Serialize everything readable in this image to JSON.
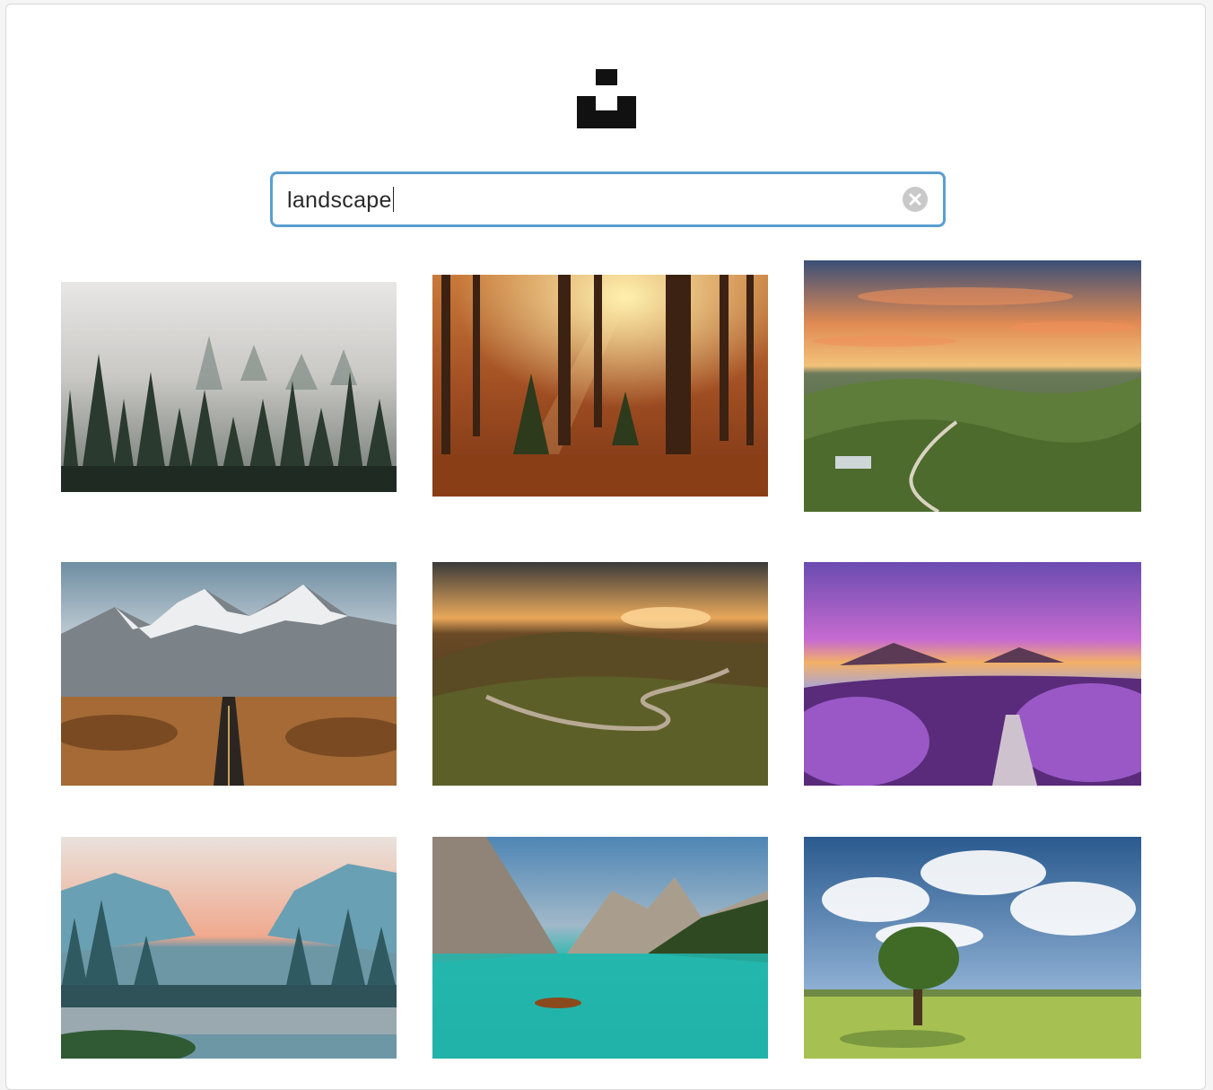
{
  "logo": {
    "icon": "unsplash-logo-icon"
  },
  "search": {
    "value": "landscape",
    "clear_icon": "clear-x-icon",
    "accent": "#5a9fd0"
  },
  "results": [
    {
      "subject": "misty-pine-forest"
    },
    {
      "subject": "autumn-forest-sunbeams"
    },
    {
      "subject": "rolling-hills-sunset"
    },
    {
      "subject": "snowy-mountains-desert-road"
    },
    {
      "subject": "winding-road-hills-sunset"
    },
    {
      "subject": "lavender-lake-purple-sky"
    },
    {
      "subject": "valley-river-pink-sky"
    },
    {
      "subject": "turquoise-lake-boat-mountains"
    },
    {
      "subject": "lone-tree-meadow-clouds"
    }
  ]
}
